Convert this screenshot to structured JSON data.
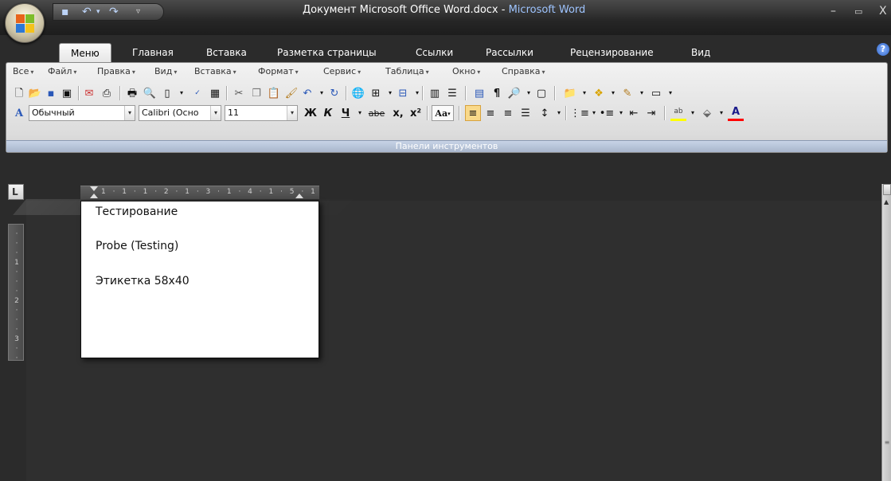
{
  "window": {
    "title_doc": "Документ Microsoft Office Word.docx - ",
    "title_app": "Microsoft Word",
    "minimize": "–",
    "maximize": "▭",
    "close": "X"
  },
  "tabs": [
    {
      "label": "Меню",
      "active": true
    },
    {
      "label": "Главная"
    },
    {
      "label": "Вставка"
    },
    {
      "label": "Разметка страницы"
    },
    {
      "label": "Ссылки"
    },
    {
      "label": "Рассылки"
    },
    {
      "label": "Рецензирование"
    },
    {
      "label": "Вид"
    }
  ],
  "menubar": [
    "Все",
    "Файл",
    "Правка",
    "Вид",
    "Вставка",
    "Формат",
    "Сервис",
    "Таблица",
    "Окно",
    "Справка"
  ],
  "toolbar": {
    "style_value": "Обычный",
    "font_value": "Calibri (Осно",
    "size_value": "11",
    "bold_label": "Ж",
    "italic_label": "К",
    "underline_label": "Ч",
    "strike_label": "abe",
    "subscript_label": "x,",
    "superscript_label": "x²",
    "case_label": "Aa",
    "styles_glyph": "A"
  },
  "ribbon_group": "Панели инструментов",
  "ruler": {
    "h_marks": "1 · 1 · 1 · 2 · 1 · 3 · 1 · 4 · 1 · 5 · 1",
    "corner_glyph": "L"
  },
  "document": {
    "paragraphs": [
      "Тестирование",
      "Probe (Testing)",
      "Этикетка 58x40"
    ]
  },
  "colors": {
    "highlight": "#ffff00",
    "font_color": "#ff0000"
  }
}
